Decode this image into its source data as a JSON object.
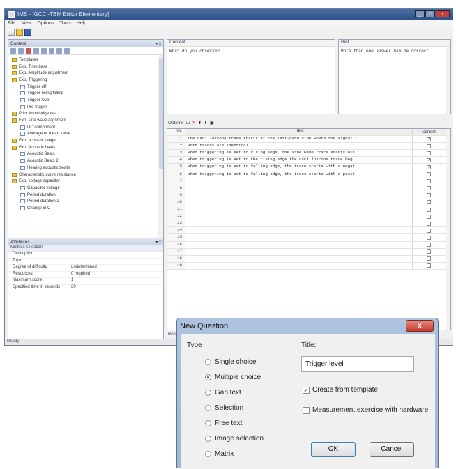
{
  "window": {
    "title": "IMS - [GCCI-TBM Editor Elementary]",
    "menu": [
      "File",
      "View",
      "Options",
      "Tools",
      "Help"
    ]
  },
  "left_panel": {
    "header": "Content",
    "tree": [
      {
        "label": "Templates",
        "level": 0,
        "icon": "folder"
      },
      {
        "label": "Exp. Time base",
        "level": 0,
        "icon": "folder"
      },
      {
        "label": "Exp. Amplitude adjustment",
        "level": 0,
        "icon": "folder"
      },
      {
        "label": "Exp. Triggering",
        "level": 0,
        "icon": "folder"
      },
      {
        "label": "Trigger off",
        "level": 1,
        "icon": "doc"
      },
      {
        "label": "Trigger rising/falling",
        "level": 1,
        "icon": "doc"
      },
      {
        "label": "Trigger level",
        "level": 1,
        "icon": "doc"
      },
      {
        "label": "Pre-trigger",
        "level": 1,
        "icon": "doc"
      },
      {
        "label": "Prior knowledge test 1",
        "level": 0,
        "icon": "folder"
      },
      {
        "label": "Exp. sine wave alignment",
        "level": 0,
        "icon": "folder"
      },
      {
        "label": "DC component",
        "level": 1,
        "icon": "doc"
      },
      {
        "label": "Average or mean value",
        "level": 1,
        "icon": "doc"
      },
      {
        "label": "Exp. acoustic range",
        "level": 0,
        "icon": "folder"
      },
      {
        "label": "Exp. Acoustic beats",
        "level": 0,
        "icon": "folder"
      },
      {
        "label": "Acoustic Beats",
        "level": 1,
        "icon": "doc"
      },
      {
        "label": "Acoustic Beats 2",
        "level": 1,
        "icon": "doc"
      },
      {
        "label": "Hearing acoustic beats",
        "level": 1,
        "icon": "doc"
      },
      {
        "label": "Characteristic curve resistance",
        "level": 0,
        "icon": "folder"
      },
      {
        "label": "Exp. voltage capacitor",
        "level": 0,
        "icon": "folder"
      },
      {
        "label": "Capacitor voltage",
        "level": 1,
        "icon": "doc"
      },
      {
        "label": "Period duration",
        "level": 1,
        "icon": "doc"
      },
      {
        "label": "Period duration 2",
        "level": 1,
        "icon": "doc"
      },
      {
        "label": "Change in C",
        "level": 1,
        "icon": "doc"
      }
    ]
  },
  "properties": {
    "header": "Attributes",
    "subheader": "Multiple selection",
    "rows": [
      {
        "key": "Description",
        "value": ""
      },
      {
        "key": "Topic",
        "value": ""
      },
      {
        "key": "Degree of difficulty",
        "value": "undetermined"
      },
      {
        "key": "Resources",
        "value": "0 required"
      },
      {
        "key": "Maximum score",
        "value": "1"
      },
      {
        "key": "Specified time in seconds",
        "value": "30"
      }
    ]
  },
  "question_box": {
    "header": "Content",
    "text": "What do you observe?"
  },
  "hint_box": {
    "header": "Hint",
    "text": "More than one answer may be correct"
  },
  "options_bar": {
    "label": "Options"
  },
  "answers_grid": {
    "headers": {
      "no": "No.",
      "text": "Text",
      "correct": "Correct"
    },
    "rows": [
      {
        "no": "1",
        "text": "The oscilloscope trace starts at the left-hand side where the signal i",
        "correct": true
      },
      {
        "no": "2",
        "text": "Both traces are identical",
        "correct": false
      },
      {
        "no": "3",
        "text": "When triggering is set to rising edge, the sine wave trace starts wit",
        "correct": false
      },
      {
        "no": "4",
        "text": "When triggering is set to the rising edge the oscilloscope trace beg",
        "correct": true
      },
      {
        "no": "5",
        "text": "When triggering is set to falling edge, the trace starts with a negat",
        "correct": true
      },
      {
        "no": "6",
        "text": "When triggering is set to falling edge, the trace starts with a posit",
        "correct": false
      },
      {
        "no": "7",
        "text": "",
        "correct": false
      },
      {
        "no": "8",
        "text": "",
        "correct": false
      },
      {
        "no": "9",
        "text": "",
        "correct": false
      },
      {
        "no": "10",
        "text": "",
        "correct": false
      },
      {
        "no": "11",
        "text": "",
        "correct": false
      },
      {
        "no": "12",
        "text": "",
        "correct": false
      },
      {
        "no": "13",
        "text": "",
        "correct": false
      },
      {
        "no": "14",
        "text": "",
        "correct": false
      },
      {
        "no": "15",
        "text": "",
        "correct": false
      },
      {
        "no": "16",
        "text": "",
        "correct": false
      },
      {
        "no": "17",
        "text": "",
        "correct": false
      },
      {
        "no": "18",
        "text": "",
        "correct": false
      },
      {
        "no": "19",
        "text": "",
        "correct": false
      }
    ]
  },
  "return_label": "Return",
  "status": "Ready",
  "dialog": {
    "title": "New Question",
    "close_label": "x",
    "type_label": "Type",
    "types": [
      {
        "label": "Single choice",
        "selected": false
      },
      {
        "label": "Multiple choice",
        "selected": true
      },
      {
        "label": "Gap text",
        "selected": false
      },
      {
        "label": "Selection",
        "selected": false
      },
      {
        "label": "Free text",
        "selected": false
      },
      {
        "label": "Image selection",
        "selected": false
      },
      {
        "label": "Matrix",
        "selected": false
      }
    ],
    "title_label": "Title:",
    "title_value": "Trigger level",
    "checks": [
      {
        "label": "Create from template",
        "checked": true
      },
      {
        "label": "Measurement exercise with hardware",
        "checked": false
      }
    ],
    "ok_label": "OK",
    "cancel_label": "Cancel"
  }
}
